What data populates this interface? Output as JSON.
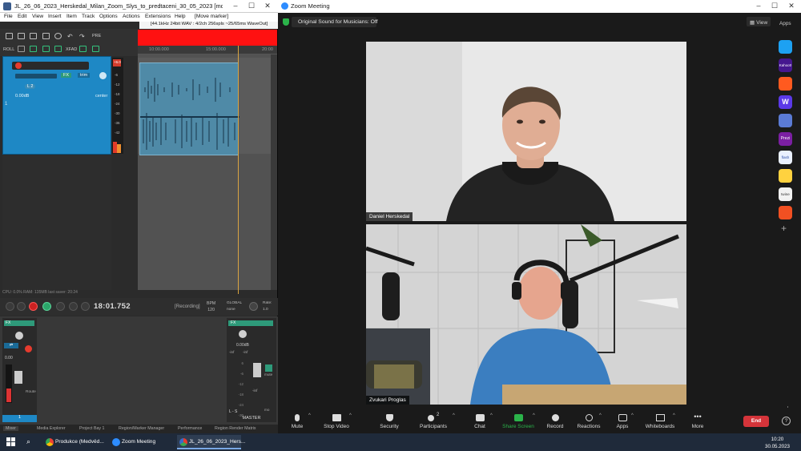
{
  "reaper": {
    "title": "JL_26_06_2023_Herskedal_Milan_Zoom_Slys_to_predtaceni_30_05_2023 [modified] - REAPER ...",
    "menu": [
      "File",
      "Edit",
      "View",
      "Insert",
      "Item",
      "Track",
      "Options",
      "Actions",
      "Extensions",
      "Help",
      "[Move marker]"
    ],
    "status": "[44.1kHz 24bit WAV : 4/2ch 256spls ~25/65ms WaveOut]",
    "ruler_ticks": [
      "10:00.000",
      "15:00.000",
      "20:00"
    ],
    "toolbar_labels": {
      "pre": "PRE",
      "roll": "ROLL",
      "xfad": "XFAD"
    },
    "track": {
      "number": "1",
      "trim_label": "FX",
      "volume": "0.00dB",
      "pan": "center",
      "send": "trim",
      "pan_badge": "L 2"
    },
    "meter_labels": [
      "+6.0",
      "-6",
      "-12",
      "-18",
      "-24",
      "-30",
      "-36",
      "-42",
      "-48",
      "-54"
    ],
    "cpu_text": "CPU: 0.0%  RAM: 135MB  last saver: 20:24",
    "time": "18:01.752",
    "recording": "[Recording]",
    "bpm_label": "BPM",
    "bpm": "120",
    "global_label": "GLOBAL",
    "global_mode": "none",
    "rate_label": "Rate:",
    "rate": "1.0",
    "mixer": {
      "strip_fx": "FX",
      "strip_db": "0.00",
      "strip_route": "Route",
      "strip_num": "1",
      "master_fx": "FX",
      "master_db": "0.00dB",
      "master_inf_l": "-inf",
      "master_inf_r": "-inf",
      "master_scale": [
        "6",
        "-6",
        "-12",
        "-18",
        "-24",
        "-30",
        "-42",
        "-54"
      ],
      "master_mute": "mute",
      "master_inf": "-inf",
      "master_lr": "L - S",
      "master_label": "MASTER",
      "master_mo": "mo"
    },
    "tabs": [
      "Mixer",
      "Media Explorer",
      "Project Bay 1",
      "Region/Marker Manager",
      "Performance",
      "Region Render Matrix"
    ]
  },
  "zoom": {
    "title": "Zoom Meeting",
    "banner": "Original Sound for Musicians: Off",
    "view": "View",
    "apps_label": "Apps",
    "participants": [
      {
        "name": "Daniel Herskedal"
      },
      {
        "name": "Zvukari Proglas"
      }
    ],
    "apps": [
      {
        "name": "arrow-app",
        "color": "#1da1f2"
      },
      {
        "name": "kahoot-app",
        "color": "#46178f",
        "label": "Kahoot!"
      },
      {
        "name": "orange-app",
        "color": "#ff5a1f"
      },
      {
        "name": "wooclap-app",
        "color": "#5b39e8",
        "label": "W"
      },
      {
        "name": "sticker-app",
        "color": "#5b7bd5"
      },
      {
        "name": "prezi-app",
        "color": "#7b1fa2",
        "label": "Prezi"
      },
      {
        "name": "flash-app",
        "color": "#eaf0ff",
        "label": "flash"
      },
      {
        "name": "smile-app",
        "color": "#ffd23f"
      },
      {
        "name": "twine-app",
        "color": "#f2f2f2",
        "label": "twine"
      },
      {
        "name": "office-app",
        "color": "#f25022"
      }
    ],
    "toolbar": [
      {
        "label": "Mute",
        "icon": "mic-icon"
      },
      {
        "label": "Stop Video",
        "icon": "video-icon"
      },
      {
        "label": "Security",
        "icon": "shield-icon"
      },
      {
        "label": "Participants",
        "icon": "participants-icon",
        "count": "2"
      },
      {
        "label": "Chat",
        "icon": "chat-icon"
      },
      {
        "label": "Share Screen",
        "icon": "share-screen-icon"
      },
      {
        "label": "Record",
        "icon": "record-icon"
      },
      {
        "label": "Reactions",
        "icon": "reactions-icon"
      },
      {
        "label": "Apps",
        "icon": "apps-icon"
      },
      {
        "label": "Whiteboards",
        "icon": "whiteboard-icon"
      },
      {
        "label": "More",
        "icon": "more-icon"
      }
    ],
    "end": "End",
    "accent": "#2bb34a",
    "end_color": "#d5343a"
  },
  "taskbar": {
    "items": [
      {
        "label": "Produkce (Medvěd...",
        "icon": "chrome-icon"
      },
      {
        "label": "Zoom Meeting",
        "icon": "zoom-icon"
      },
      {
        "label": "JL_26_06_2023_Hers...",
        "icon": "reaper-icon"
      }
    ],
    "time": "10:20",
    "date": "30.05.2023"
  }
}
